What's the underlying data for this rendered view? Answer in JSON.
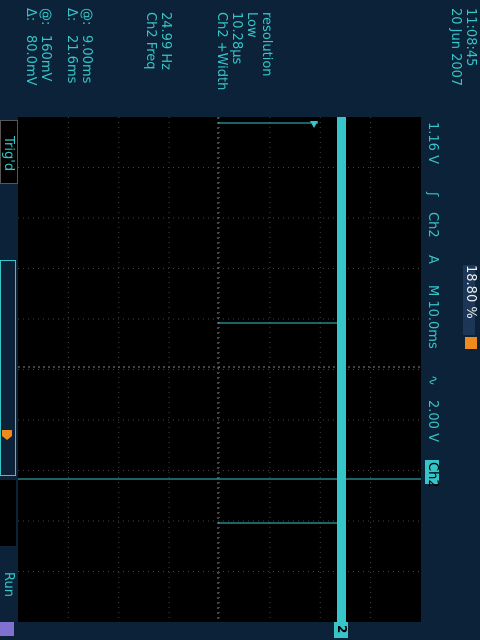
{
  "status": {
    "run": "Run",
    "trig": "Trig'd"
  },
  "measurements": {
    "delta_v": "80.0mV",
    "at_v": "160mV",
    "delta_t": "21.6ms",
    "at_t": "9.00ms",
    "delta_sym": "Δ:",
    "at_sym": "@:"
  },
  "freq": {
    "label": "Ch2 Freq",
    "value": "24.99 Hz"
  },
  "width": {
    "label": "Ch2 +Width",
    "value": "10.28µs",
    "note1": "Low",
    "note2": "resolution"
  },
  "datetime": {
    "date": "20 Jun 2007",
    "time": "11:08:45"
  },
  "bottom_readout": {
    "channel": "Ch2",
    "volts": "2.00 V",
    "bw_symbol": "∿",
    "timebase": "M 10.0ms",
    "trig_mode": "A",
    "trig_channel": "Ch2",
    "trig_slope": "ʃ",
    "trig_level": "1.16 V"
  },
  "trigger_position": "18.80 %",
  "ch2_marker": "2",
  "colors": {
    "trace": "#36c6c9",
    "background": "#0b2238",
    "screen": "#000000",
    "marker": "#f08a1a"
  }
}
